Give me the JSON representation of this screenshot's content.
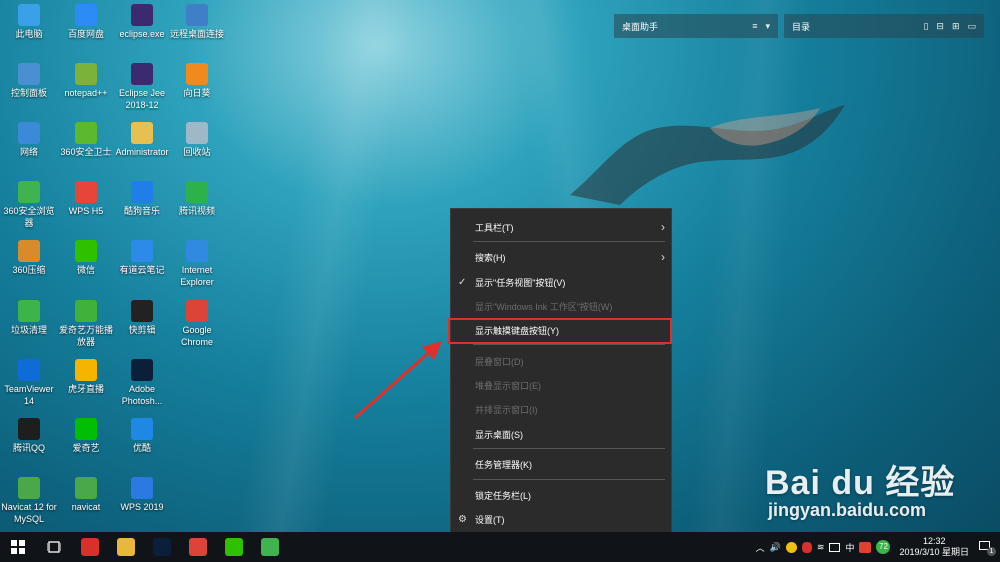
{
  "desktop_icons": [
    {
      "label": "此电脑",
      "icon": "computer-icon",
      "color": "#3aa0e8"
    },
    {
      "label": "百度网盘",
      "icon": "baidu-netdisk-icon",
      "color": "#2c8cf4"
    },
    {
      "label": "eclipse.exe",
      "icon": "eclipse-icon",
      "color": "#3b2a6e"
    },
    {
      "label": "远程桌面连接",
      "icon": "remote-desktop-icon",
      "color": "#3f7fc8"
    },
    {
      "label": "控制面板",
      "icon": "control-panel-icon",
      "color": "#4a90d0"
    },
    {
      "label": "notepad++",
      "icon": "notepadpp-icon",
      "color": "#7bb23a"
    },
    {
      "label": "Eclipse Jee 2018-12",
      "icon": "eclipse-jee-icon",
      "color": "#3b2a6e"
    },
    {
      "label": "向日葵",
      "icon": "sunflower-icon",
      "color": "#f08a1c"
    },
    {
      "label": "网络",
      "icon": "network-icon",
      "color": "#3a8ad8"
    },
    {
      "label": "360安全卫士",
      "icon": "360-safe-icon",
      "color": "#5cb82e"
    },
    {
      "label": "Administrator",
      "icon": "user-folder-icon",
      "color": "#e8c052"
    },
    {
      "label": "回收站",
      "icon": "recycle-bin-icon",
      "color": "#9fb8c8"
    },
    {
      "label": "360安全浏览器",
      "icon": "360-browser-icon",
      "color": "#3fb34f"
    },
    {
      "label": "WPS H5",
      "icon": "wps-h5-icon",
      "color": "#e8453a"
    },
    {
      "label": "酷狗音乐",
      "icon": "kugou-icon",
      "color": "#1f7ee8"
    },
    {
      "label": "腾讯视频",
      "icon": "tencent-video-icon",
      "color": "#2cb24a"
    },
    {
      "label": "360压缩",
      "icon": "360-zip-icon",
      "color": "#d98a2a"
    },
    {
      "label": "微信",
      "icon": "wechat-icon",
      "color": "#2dc100"
    },
    {
      "label": "有道云笔记",
      "icon": "youdao-note-icon",
      "color": "#2d8ae8"
    },
    {
      "label": "Internet Explorer",
      "icon": "ie-icon",
      "color": "#2f8ae0"
    },
    {
      "label": "垃圾清理",
      "icon": "cleaner-icon",
      "color": "#3cb44a"
    },
    {
      "label": "爱奇艺万能播放器",
      "icon": "iqiyi-player-icon",
      "color": "#40b23a"
    },
    {
      "label": "快剪辑",
      "icon": "kuaijianji-icon",
      "color": "#222222"
    },
    {
      "label": "Google Chrome",
      "icon": "chrome-icon",
      "color": "#db4437"
    },
    {
      "label": "TeamViewer 14",
      "icon": "teamviewer-icon",
      "color": "#0e6bd8"
    },
    {
      "label": "虎牙直播",
      "icon": "huya-icon",
      "color": "#f5b400"
    },
    {
      "label": "Adobe Photosh...",
      "icon": "photoshop-icon",
      "color": "#0b1e3a"
    },
    {
      "label": "腾讯QQ",
      "icon": "qq-icon",
      "color": "#1e1e1e"
    },
    {
      "label": "爱奇艺",
      "icon": "iqiyi-icon",
      "color": "#00be06"
    },
    {
      "label": "优酷",
      "icon": "youku-icon",
      "color": "#1f88e5"
    },
    {
      "label": "Navicat 12 for MySQL",
      "icon": "navicat-mysql-icon",
      "color": "#4aa84a"
    },
    {
      "label": "navicat",
      "icon": "navicat-icon",
      "color": "#4aa84a"
    },
    {
      "label": "WPS 2019",
      "icon": "wps-icon",
      "color": "#2a7ae2"
    }
  ],
  "widgets": {
    "left": {
      "title": "桌面助手",
      "tools": [
        "≡",
        "▾"
      ]
    },
    "right": {
      "title": "目录",
      "tools": [
        "▯",
        "⊟",
        "⊞",
        "▭"
      ]
    }
  },
  "context_menu": {
    "items": [
      {
        "label": "工具栏(T)",
        "submenu": true,
        "disabled": false
      },
      {
        "label": "搜索(H)",
        "submenu": true,
        "disabled": false
      },
      {
        "label": "显示\"任务视图\"按钮(V)",
        "checked": true,
        "disabled": false
      },
      {
        "label": "显示\"Windows Ink 工作区\"按钮(W)",
        "disabled": true
      },
      {
        "label": "显示触摸键盘按钮(Y)",
        "disabled": false,
        "highlighted": true
      },
      {
        "label": "层叠窗口(D)",
        "disabled": true
      },
      {
        "label": "堆叠显示窗口(E)",
        "disabled": true
      },
      {
        "label": "并排显示窗口(I)",
        "disabled": true
      },
      {
        "label": "显示桌面(S)",
        "disabled": false
      },
      {
        "label": "任务管理器(K)",
        "disabled": false
      },
      {
        "label": "锁定任务栏(L)",
        "disabled": false
      },
      {
        "label": "设置(T)",
        "disabled": false,
        "icon": "gear-icon"
      }
    ]
  },
  "taskbar": {
    "apps": [
      {
        "name": "qq-icon",
        "color": "#d8302a"
      },
      {
        "name": "file-explorer-icon",
        "color": "#e8b83a"
      },
      {
        "name": "photoshop-icon",
        "color": "#0b1e3a"
      },
      {
        "name": "chrome-icon",
        "color": "#db4437"
      },
      {
        "name": "wechat-icon",
        "color": "#2dc100"
      },
      {
        "name": "360-browser-icon",
        "color": "#3fb34f"
      }
    ],
    "tray": {
      "ime": "中",
      "badge": "72",
      "time": "12:32",
      "date": "2019/3/10 星期日",
      "notification_count": "1"
    }
  },
  "watermark": {
    "brand": "Bai du 经验",
    "url": "jingyan.baidu.com"
  }
}
